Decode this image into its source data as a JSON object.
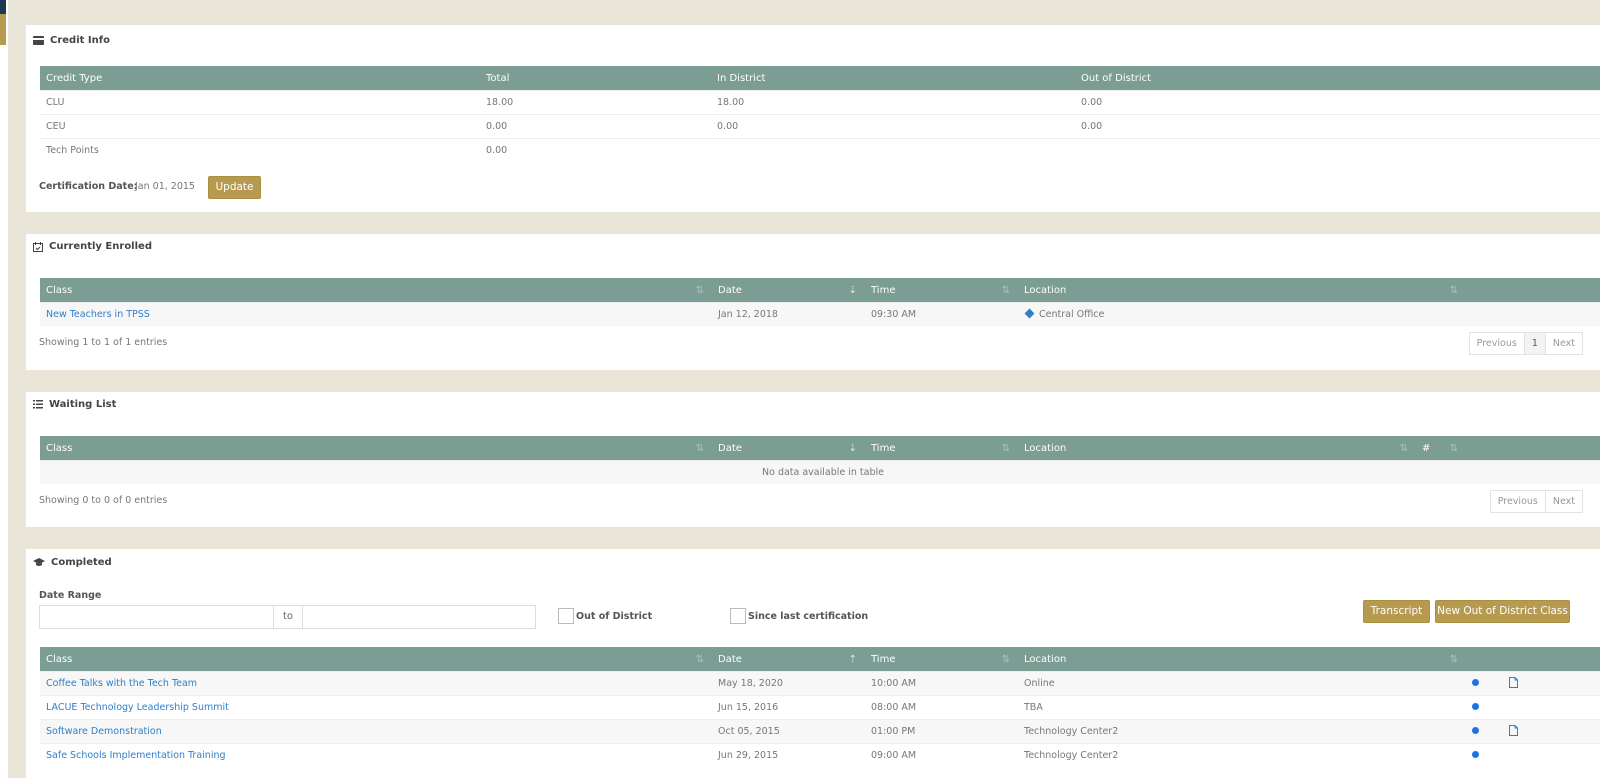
{
  "credit_info": {
    "title": "Credit Info",
    "headers": [
      "Credit Type",
      "Total",
      "In District",
      "Out of District"
    ],
    "rows": [
      [
        "CLU",
        "18.00",
        "18.00",
        "0.00"
      ],
      [
        "CEU",
        "0.00",
        "0.00",
        "0.00"
      ],
      [
        "Tech Points",
        "0.00",
        "",
        ""
      ]
    ],
    "cert_label": "Certification Date:",
    "cert_value": "Jan 01, 2015",
    "update_label": "Update"
  },
  "enrolled": {
    "title": "Currently Enrolled",
    "headers": [
      "Class",
      "Date",
      "Time",
      "Location"
    ],
    "rows": [
      {
        "class": "New Teachers in TPSS",
        "date": "Jan 12, 2018",
        "time": "09:30 AM",
        "location": "Central Office"
      }
    ],
    "info": "Showing 1 to 1 of 1 entries",
    "pager": {
      "previous": "Previous",
      "page": "1",
      "next": "Next"
    }
  },
  "waiting": {
    "title": "Waiting List",
    "headers": [
      "Class",
      "Date",
      "Time",
      "Location",
      "#"
    ],
    "empty": "No data available in table",
    "info": "Showing 0 to 0 of 0 entries",
    "pager": {
      "previous": "Previous",
      "next": "Next"
    }
  },
  "completed": {
    "title": "Completed",
    "date_range_label": "Date Range",
    "to_label": "to",
    "out_of_district_label": "Out of District",
    "since_cert_label": "Since last certification",
    "transcript_label": "Transcript",
    "new_ood_label": "New Out of District Class",
    "headers": [
      "Class",
      "Date",
      "Time",
      "Location"
    ],
    "rows": [
      {
        "class": "Coffee Talks with the Tech Team",
        "date": "May 18, 2020",
        "time": "10:00 AM",
        "location": "Online",
        "doc": true
      },
      {
        "class": "LACUE Technology Leadership Summit",
        "date": "Jun 15, 2016",
        "time": "08:00 AM",
        "location": "TBA",
        "doc": false
      },
      {
        "class": "Software Demonstration",
        "date": "Oct 05, 2015",
        "time": "01:00 PM",
        "location": "Technology Center2",
        "doc": true
      },
      {
        "class": "Safe Schools Implementation Training",
        "date": "Jun 29, 2015",
        "time": "09:00 AM",
        "location": "Technology Center2",
        "doc": false
      }
    ]
  },
  "colors": {
    "header": "#7c9d94",
    "accent": "#b59a50",
    "link": "#2f7fc8",
    "background": "#e9e6d9"
  }
}
